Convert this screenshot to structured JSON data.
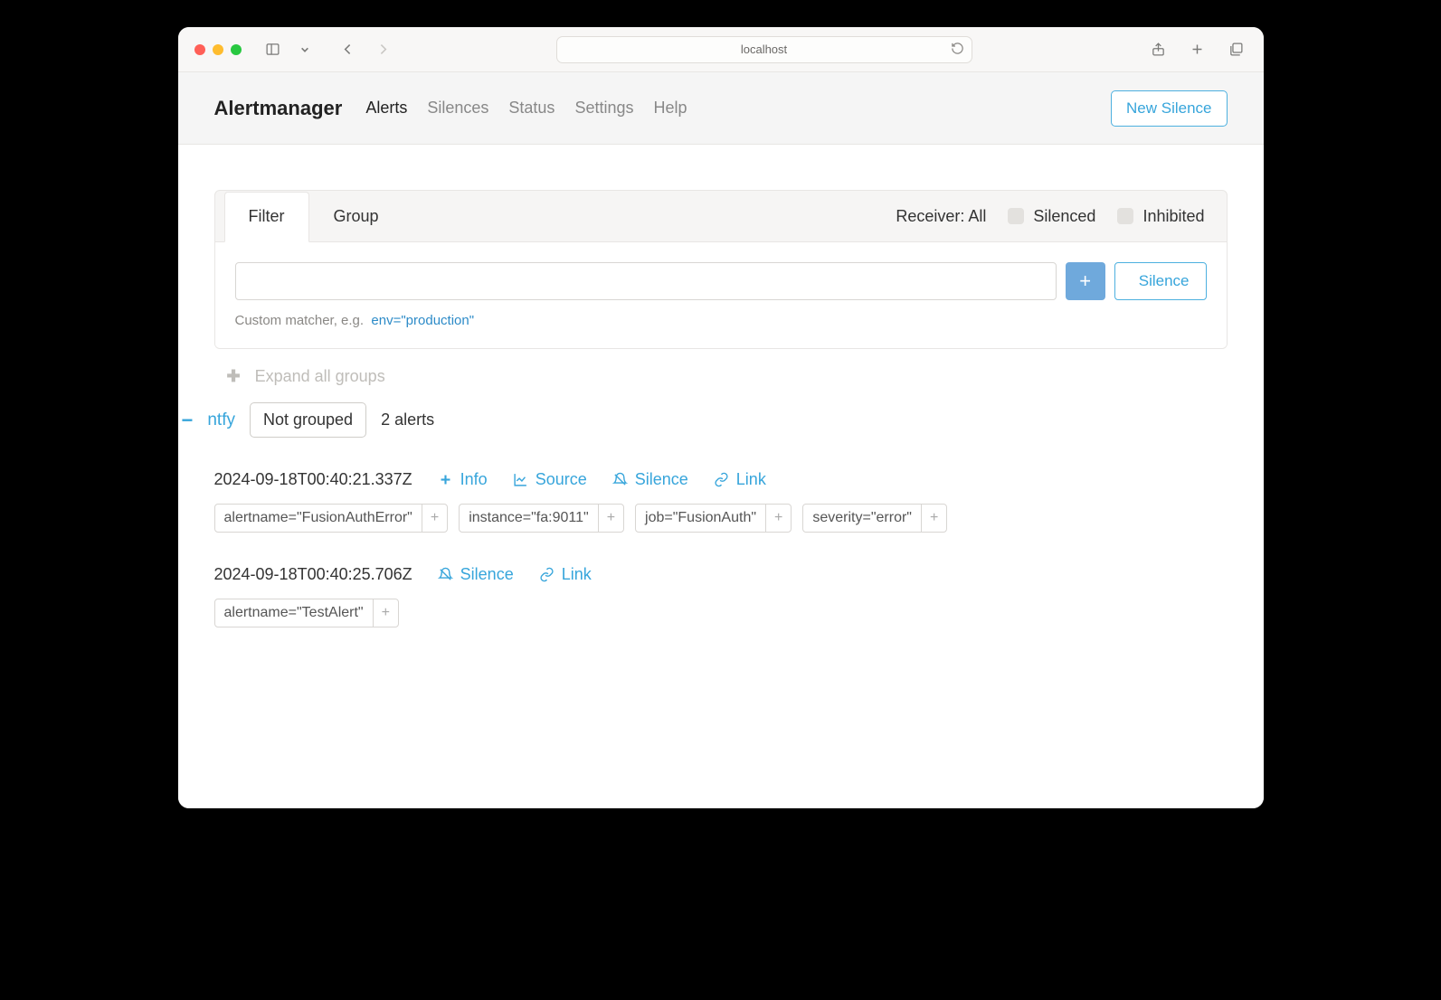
{
  "browser": {
    "address": "localhost"
  },
  "nav": {
    "brand": "Alertmanager",
    "links": [
      "Alerts",
      "Silences",
      "Status",
      "Settings",
      "Help"
    ],
    "active": 0,
    "new_silence": "New Silence"
  },
  "filter": {
    "tabs": {
      "filter": "Filter",
      "group": "Group"
    },
    "receiver_label": "Receiver: All",
    "silenced": "Silenced",
    "inhibited": "Inhibited",
    "silence_btn": "Silence",
    "hint_prefix": "Custom matcher, e.g.",
    "hint_example": "env=\"production\""
  },
  "expand_all": "Expand all groups",
  "group": {
    "name": "ntfy",
    "not_grouped": "Not grouped",
    "count": "2 alerts"
  },
  "alerts": [
    {
      "ts": "2024-09-18T00:40:21.337Z",
      "actions": {
        "info": "Info",
        "source": "Source",
        "silence": "Silence",
        "link": "Link"
      },
      "labels": [
        "alertname=\"FusionAuthError\"",
        "instance=\"fa:9011\"",
        "job=\"FusionAuth\"",
        "severity=\"error\""
      ]
    },
    {
      "ts": "2024-09-18T00:40:25.706Z",
      "actions": {
        "silence": "Silence",
        "link": "Link"
      },
      "labels": [
        "alertname=\"TestAlert\""
      ]
    }
  ]
}
